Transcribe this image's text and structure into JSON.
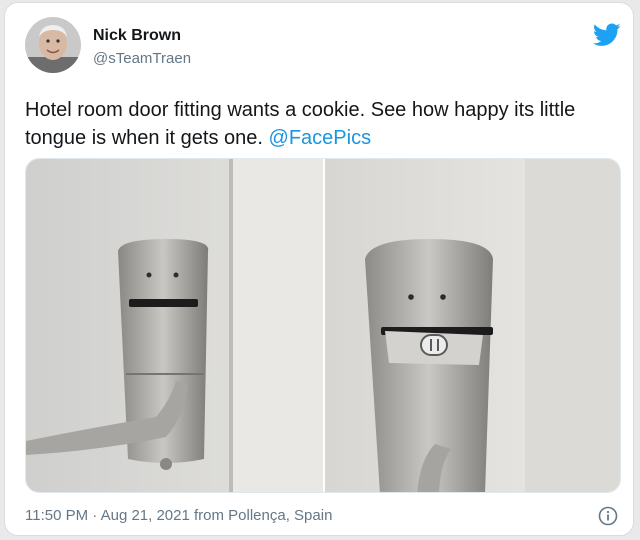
{
  "tweet": {
    "author_name": "Nick Brown",
    "author_handle": "@sTeamTraen",
    "text_main": "Hotel room door fitting wants a cookie. See how happy its little tongue is when it gets one.",
    "mention": "@FacePics",
    "footer": "11:50 PM · Aug 21, 2021 from Pollença, Spain"
  },
  "icons": {
    "logo": "twitter-bird-icon",
    "info": "info-icon"
  },
  "colors": {
    "text": "#14171a",
    "secondary": "#657786",
    "link": "#1b95e0",
    "brand": "#1da1f2"
  }
}
